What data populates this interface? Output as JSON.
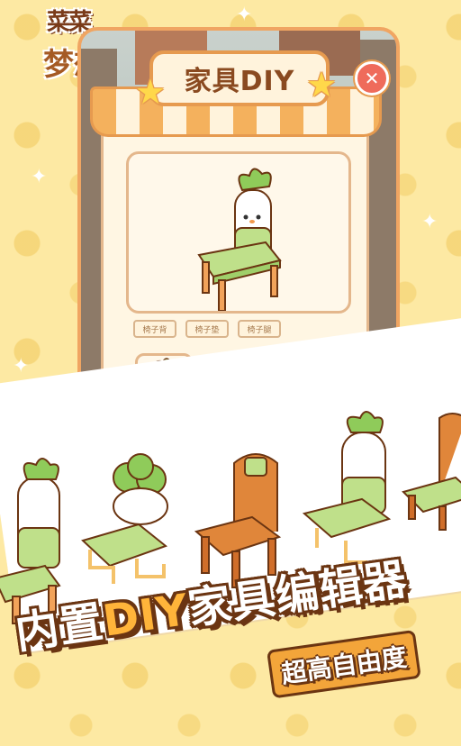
{
  "app": {
    "logo_title": "梦想家",
    "logo_prefix": "菜菜"
  },
  "dialog": {
    "title": "家具DIY",
    "close_icon": "close-icon"
  },
  "part_tabs": [
    {
      "label": "椅子背"
    },
    {
      "label": "椅子垫"
    },
    {
      "label": "椅子腿"
    }
  ],
  "options": [
    {
      "icon": "radish-backrest-icon"
    },
    {
      "icon": "broccoli-backrest-icon"
    },
    {
      "icon": "wooden-backrest-icon"
    }
  ],
  "promo": {
    "slogan_part1": "内置",
    "slogan_highlight": "DIY",
    "slogan_part2": "家具编辑器",
    "sub_slogan": "超高自由度"
  },
  "colors": {
    "accent": "#f4b15d",
    "border": "#e69a4f",
    "text": "#8a4a20",
    "background": "#fde9a3"
  }
}
